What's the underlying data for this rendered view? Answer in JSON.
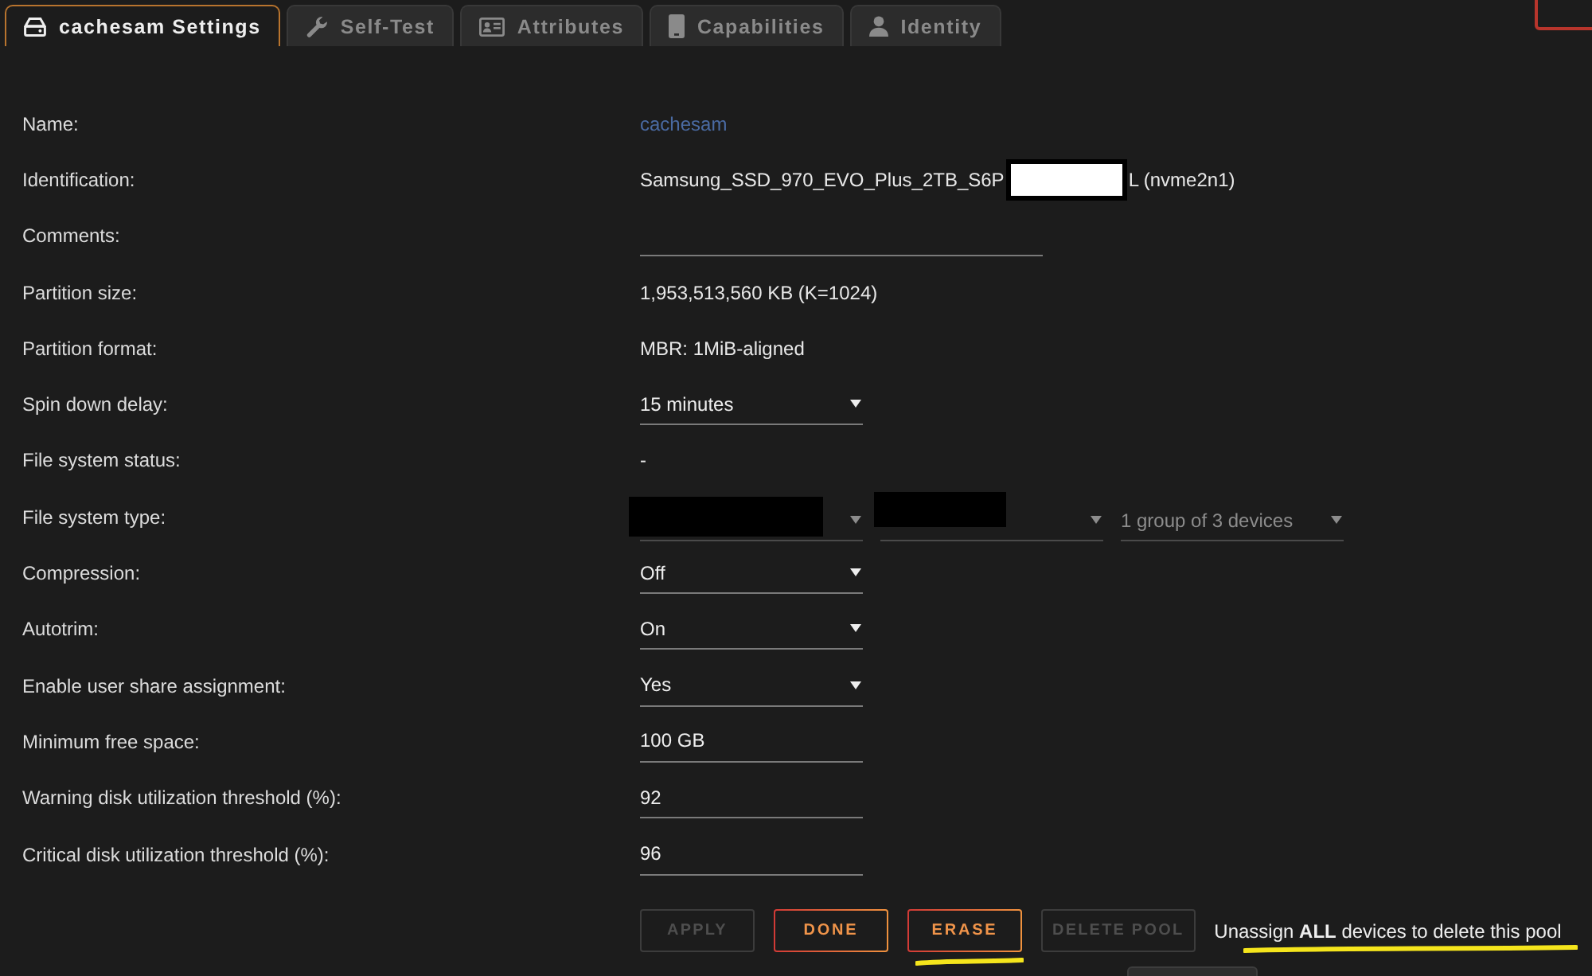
{
  "tabs": [
    {
      "label": "cachesam Settings",
      "selected": true
    },
    {
      "label": "Self-Test",
      "selected": false
    },
    {
      "label": "Attributes",
      "selected": false
    },
    {
      "label": "Capabilities",
      "selected": false
    },
    {
      "label": "Identity",
      "selected": false
    }
  ],
  "rows": [
    {
      "label": "Name:",
      "kind": "link",
      "value": "cachesam"
    },
    {
      "label": "Identification:",
      "kind": "redacted_text",
      "parts": [
        "Samsung_SSD_970_EVO_Plus_2TB_S6P",
        "L (nvme2n1)"
      ]
    },
    {
      "label": "Comments:",
      "kind": "input",
      "wide": true
    },
    {
      "label": "Partition size:",
      "kind": "text",
      "value": "1,953,513,560 KB (K=1024)"
    },
    {
      "label": "Partition format:",
      "kind": "text",
      "value": "MBR: 1MiB-aligned"
    },
    {
      "label": "Spin down delay:",
      "kind": "select",
      "value": "15 minutes"
    },
    {
      "label": "File system status:",
      "kind": "text",
      "value": "-"
    },
    {
      "label": "File system type:",
      "kind": "multi_select",
      "selects": [
        {
          "redacted": true,
          "disabled": true
        },
        {
          "redacted": true,
          "disabled": true
        },
        {
          "value": "1 group of 3 devices",
          "redacted": false,
          "disabled": true
        }
      ]
    },
    {
      "label": "Compression:",
      "kind": "select",
      "value": "Off"
    },
    {
      "label": "Autotrim:",
      "kind": "select",
      "value": "On"
    },
    {
      "label": "Enable user share assignment:",
      "kind": "select",
      "value": "Yes"
    },
    {
      "label": "Minimum free space:",
      "kind": "input",
      "value": "100 GB"
    },
    {
      "label": "Warning disk utilization threshold (%):",
      "kind": "input",
      "value": "92"
    },
    {
      "label": "Critical disk utilization threshold (%):",
      "kind": "input",
      "value": "96"
    }
  ],
  "buttons": [
    {
      "label": "APPLY",
      "disabled": true,
      "underlined": false
    },
    {
      "label": "DONE",
      "disabled": false,
      "underlined": false
    },
    {
      "label": "ERASE",
      "disabled": false,
      "underlined": true
    },
    {
      "label": "DELETE POOL",
      "disabled": true,
      "underlined": false
    }
  ],
  "note": {
    "text": "Unassign **ALL** devices to delete this pool",
    "underlined": true
  }
}
